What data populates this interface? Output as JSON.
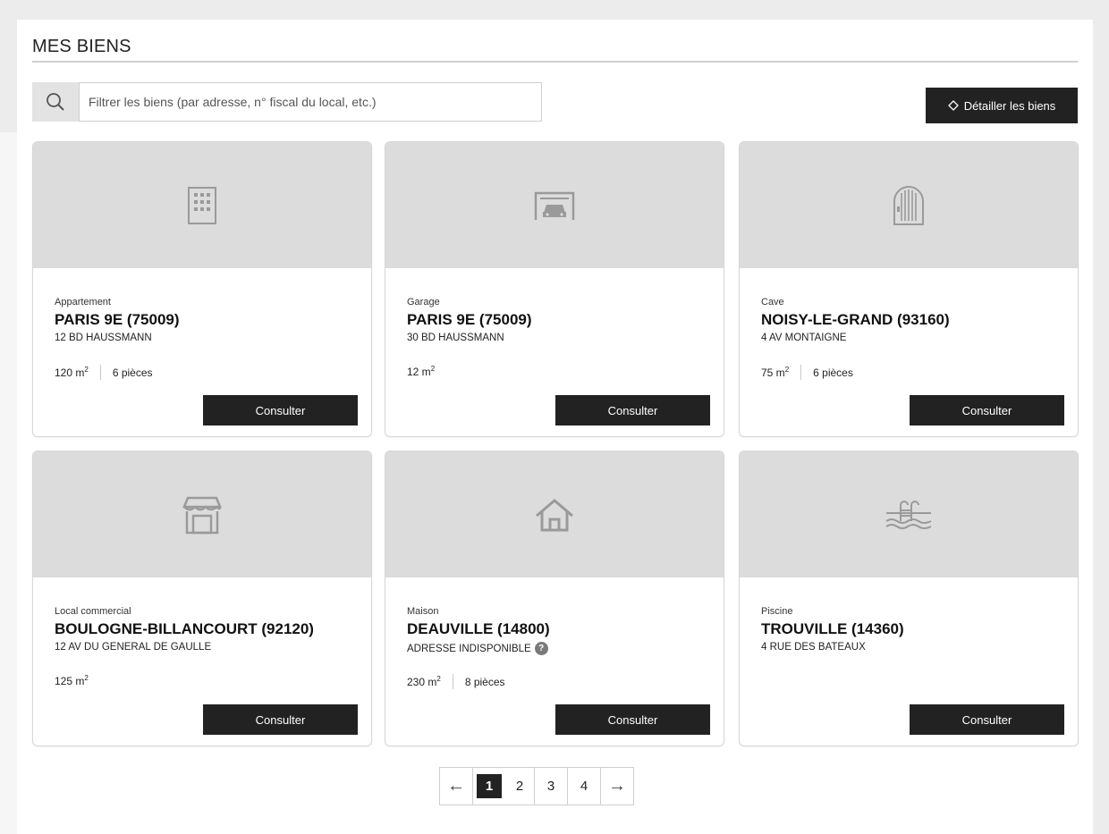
{
  "page_title": "MES BIENS",
  "search": {
    "placeholder": "Filtrer les biens (par adresse, n° fiscal du local, etc.)",
    "value": ""
  },
  "detail_button": {
    "label": "Détailler les biens"
  },
  "consult_label": "Consulter",
  "properties": [
    {
      "icon": "building-icon",
      "type": "Appartement",
      "city": "PARIS 9E (75009)",
      "address": "12 BD HAUSSMANN",
      "area": "120 m",
      "rooms": "6 pièces"
    },
    {
      "icon": "garage-icon",
      "type": "Garage",
      "city": "PARIS 9E (75009)",
      "address": "30 BD HAUSSMANN",
      "area": "12 m",
      "rooms": ""
    },
    {
      "icon": "cellar-door-icon",
      "type": "Cave",
      "city": "NOISY-LE-GRAND (93160)",
      "address": "4 AV MONTAIGNE",
      "area": "75 m",
      "rooms": "6 pièces"
    },
    {
      "icon": "shop-icon",
      "type": "Local commercial",
      "city": "BOULOGNE-BILLANCOURT (92120)",
      "address": "12 AV DU GENERAL DE GAULLE",
      "area": "125 m",
      "rooms": ""
    },
    {
      "icon": "house-icon",
      "type": "Maison",
      "city": "DEAUVILLE (14800)",
      "address": "ADRESSE INDISPONIBLE",
      "area": "230 m",
      "rooms": "8 pièces"
    },
    {
      "icon": "pool-icon",
      "type": "Piscine",
      "city": "TROUVILLE (14360)",
      "address": "4 RUE DES BATEAUX",
      "area": "",
      "rooms": ""
    }
  ],
  "pagination": {
    "prev": "←",
    "next": "→",
    "pages": [
      "1",
      "2",
      "3",
      "4"
    ],
    "current": "1"
  },
  "colors": {
    "dark": "#222222",
    "card_image_bg": "#dcdcdc",
    "page_bg": "#ececec"
  }
}
